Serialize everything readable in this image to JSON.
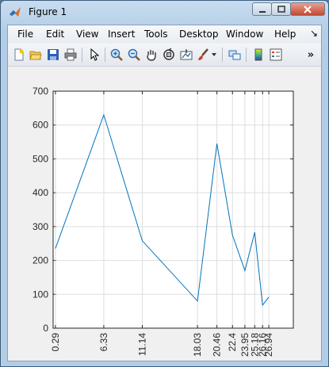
{
  "window": {
    "title": "Figure 1"
  },
  "menu": [
    "File",
    "Edit",
    "View",
    "Insert",
    "Tools",
    "Desktop",
    "Window",
    "Help"
  ],
  "toolbar_icons": [
    "new-figure-icon",
    "open-file-icon",
    "save-icon",
    "print-icon",
    "pointer-icon",
    "zoom-in-icon",
    "zoom-out-icon",
    "pan-icon",
    "rotate-3d-icon",
    "data-cursor-icon",
    "brush-icon",
    "link-plot-icon",
    "colorbar-icon",
    "legend-icon"
  ],
  "toolbar_overflow": "»",
  "chart_data": {
    "type": "line",
    "x": [
      0.29,
      6.33,
      11.14,
      18.03,
      20.46,
      22.4,
      23.95,
      25.18,
      26.16,
      26.94
    ],
    "y": [
      235,
      630,
      258,
      80,
      545,
      275,
      170,
      283,
      68,
      92
    ],
    "xticks": [
      "0.29",
      "6.33",
      "11.14",
      "18.03",
      "20.46",
      "22.4",
      "23.95",
      "25.18",
      "26.16",
      "26.94"
    ],
    "yticks": [
      "0",
      "100",
      "200",
      "300",
      "400",
      "500",
      "600",
      "700"
    ],
    "ylim": [
      0,
      700
    ],
    "xlim": [
      0,
      30
    ],
    "grid": true,
    "line_color": "#0072bd",
    "xtick_rotation": "vertical"
  }
}
